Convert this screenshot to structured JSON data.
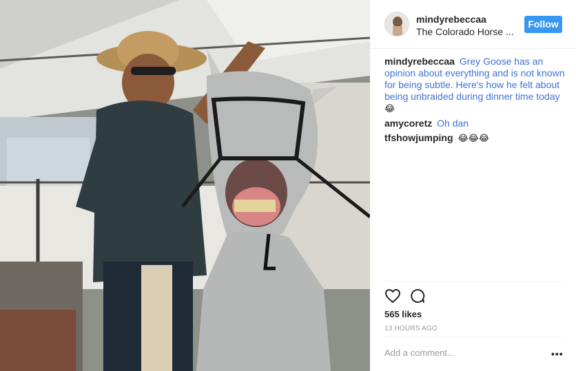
{
  "post": {
    "image_alt": "Man in straw cowboy hat holding grey horse with open mouth",
    "author": "mindyrebeccaa",
    "location": "The Colorado Horse ...",
    "follow_label": "Follow",
    "comments": [
      {
        "user": "mindyrebeccaa",
        "text": "Grey Goose has an opinion about everything and is not known for being subtle. Here's how he felt about being unbraided during dinner time today",
        "emoji": "😂"
      },
      {
        "user": "amycoretz",
        "text": "Oh dan",
        "emoji": ""
      },
      {
        "user": "tfshowjumping",
        "text": "",
        "emoji": "😂😂😂"
      }
    ],
    "likes": "565 likes",
    "timestamp": "13 HOURS AGO",
    "add_comment_placeholder": "Add a comment...",
    "more_options": "•••"
  },
  "icons": {
    "like": "heart-icon",
    "comment": "speech-bubble-icon",
    "more": "more-options-icon"
  },
  "colors": {
    "follow_button": "#3897f0",
    "link_text": "#3f72d6",
    "muted_text": "#999999"
  }
}
